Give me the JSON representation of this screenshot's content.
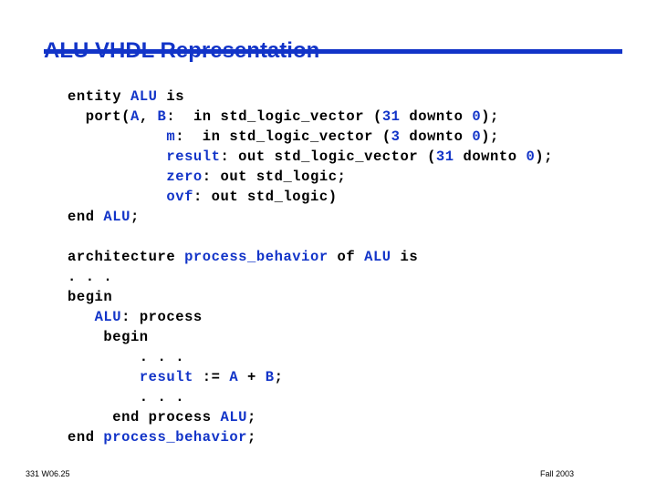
{
  "slide": {
    "title": "ALU VHDL Representation",
    "accent_color": "#1234c8",
    "text_color": "#000000",
    "background_color": "#ffffff"
  },
  "code": {
    "language": "VHDL",
    "lines": [
      {
        "id": "line-entity",
        "segments": [
          {
            "text": "entity ",
            "highlight": false
          },
          {
            "text": "ALU",
            "highlight": true
          },
          {
            "text": " is",
            "highlight": false
          }
        ]
      },
      {
        "id": "line-port-a-b",
        "segments": [
          {
            "text": "  port(",
            "highlight": false
          },
          {
            "text": "A",
            "highlight": true
          },
          {
            "text": ", ",
            "highlight": false
          },
          {
            "text": "B",
            "highlight": true
          },
          {
            "text": ":  in std_logic_vector (",
            "highlight": false
          },
          {
            "text": "31",
            "highlight": true
          },
          {
            "text": " downto ",
            "highlight": false
          },
          {
            "text": "0",
            "highlight": true
          },
          {
            "text": ");",
            "highlight": false
          }
        ]
      },
      {
        "id": "line-port-m",
        "segments": [
          {
            "text": "           ",
            "highlight": false
          },
          {
            "text": "m",
            "highlight": true
          },
          {
            "text": ":  in std_logic_vector (",
            "highlight": false
          },
          {
            "text": "3",
            "highlight": true
          },
          {
            "text": " downto ",
            "highlight": false
          },
          {
            "text": "0",
            "highlight": true
          },
          {
            "text": ");",
            "highlight": false
          }
        ]
      },
      {
        "id": "line-port-result",
        "segments": [
          {
            "text": "           ",
            "highlight": false
          },
          {
            "text": "result",
            "highlight": true
          },
          {
            "text": ": out std_logic_vector (",
            "highlight": false
          },
          {
            "text": "31",
            "highlight": true
          },
          {
            "text": " downto ",
            "highlight": false
          },
          {
            "text": "0",
            "highlight": true
          },
          {
            "text": ");",
            "highlight": false
          }
        ]
      },
      {
        "id": "line-port-zero",
        "segments": [
          {
            "text": "           ",
            "highlight": false
          },
          {
            "text": "zero",
            "highlight": true
          },
          {
            "text": ": out std_logic;",
            "highlight": false
          }
        ]
      },
      {
        "id": "line-port-ovf",
        "segments": [
          {
            "text": "           ",
            "highlight": false
          },
          {
            "text": "ovf",
            "highlight": true
          },
          {
            "text": ": out std_logic)",
            "highlight": false
          }
        ]
      },
      {
        "id": "line-end-alu",
        "segments": [
          {
            "text": "end ",
            "highlight": false
          },
          {
            "text": "ALU",
            "highlight": true
          },
          {
            "text": ";",
            "highlight": false
          }
        ]
      },
      {
        "id": "line-blank-1",
        "segments": [
          {
            "text": " ",
            "highlight": false
          }
        ]
      },
      {
        "id": "line-architecture",
        "segments": [
          {
            "text": "architecture ",
            "highlight": false
          },
          {
            "text": "process_behavior",
            "highlight": true
          },
          {
            "text": " of ",
            "highlight": false
          },
          {
            "text": "ALU",
            "highlight": true
          },
          {
            "text": " is",
            "highlight": false
          }
        ]
      },
      {
        "id": "line-ellipsis-1",
        "segments": [
          {
            "text": ". . .",
            "highlight": false
          }
        ]
      },
      {
        "id": "line-begin-arch",
        "segments": [
          {
            "text": "begin",
            "highlight": false
          }
        ]
      },
      {
        "id": "line-process-label",
        "segments": [
          {
            "text": "   ",
            "highlight": false
          },
          {
            "text": "ALU",
            "highlight": true
          },
          {
            "text": ": process",
            "highlight": false
          }
        ]
      },
      {
        "id": "line-begin-process",
        "segments": [
          {
            "text": "    begin",
            "highlight": false
          }
        ]
      },
      {
        "id": "line-ellipsis-2",
        "segments": [
          {
            "text": "        . . .",
            "highlight": false
          }
        ]
      },
      {
        "id": "line-assign-result",
        "segments": [
          {
            "text": "        ",
            "highlight": false
          },
          {
            "text": "result",
            "highlight": true
          },
          {
            "text": " := ",
            "highlight": false
          },
          {
            "text": "A",
            "highlight": true
          },
          {
            "text": " + ",
            "highlight": false
          },
          {
            "text": "B",
            "highlight": true
          },
          {
            "text": ";",
            "highlight": false
          }
        ]
      },
      {
        "id": "line-ellipsis-3",
        "segments": [
          {
            "text": "        . . .",
            "highlight": false
          }
        ]
      },
      {
        "id": "line-end-process",
        "segments": [
          {
            "text": "     end process ",
            "highlight": false
          },
          {
            "text": "ALU",
            "highlight": true
          },
          {
            "text": ";",
            "highlight": false
          }
        ]
      },
      {
        "id": "line-end-architecture",
        "segments": [
          {
            "text": "end ",
            "highlight": false
          },
          {
            "text": "process_behavior",
            "highlight": true
          },
          {
            "text": ";",
            "highlight": false
          }
        ]
      }
    ]
  },
  "footer": {
    "left": "331 W06.25",
    "right": "Fall 2003"
  }
}
